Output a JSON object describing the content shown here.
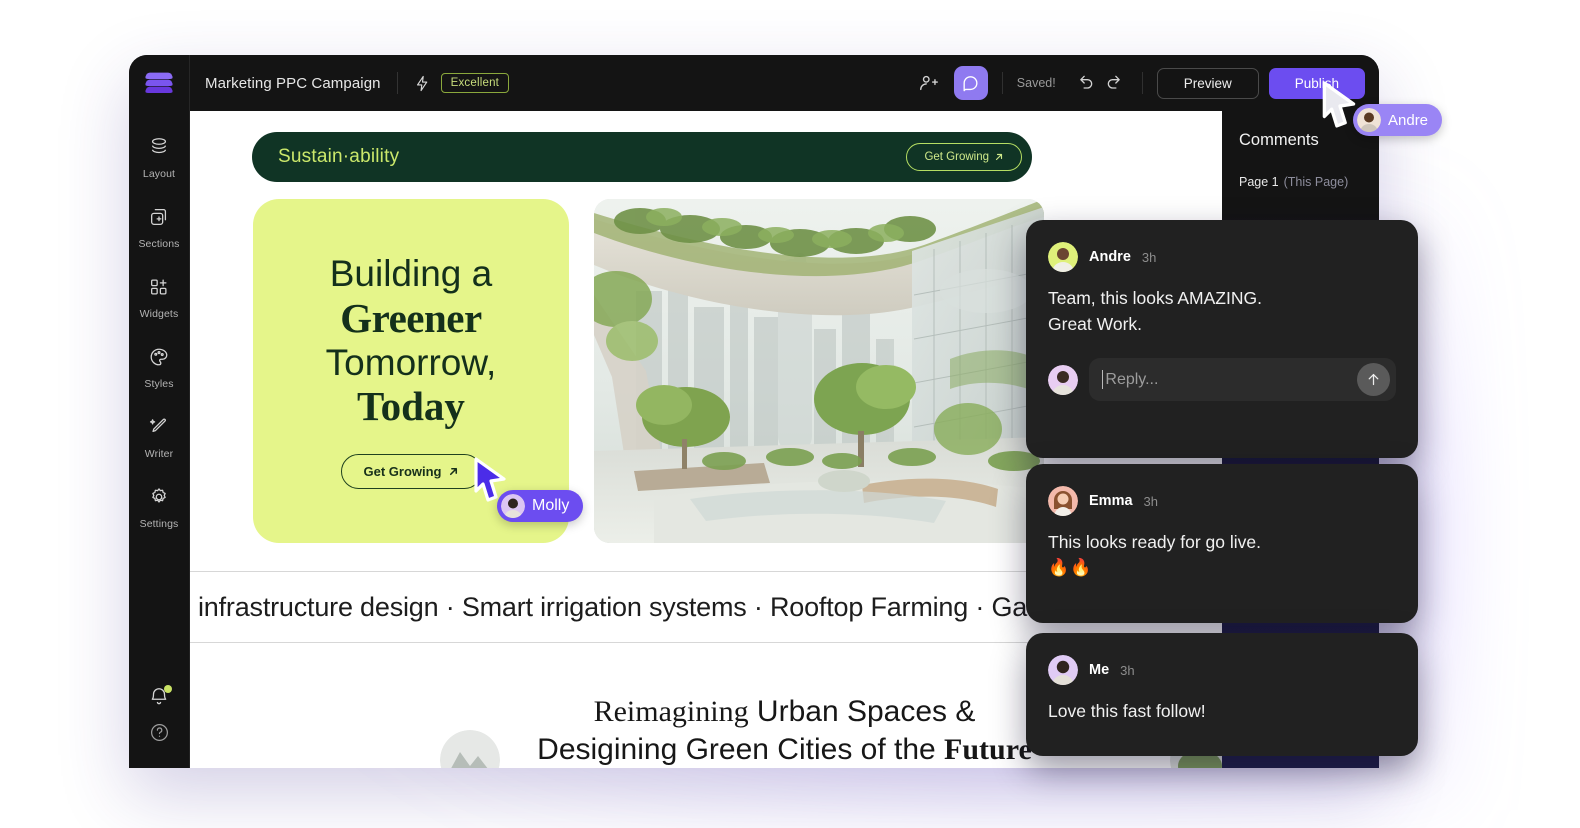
{
  "app": {
    "logo": "layers-logo",
    "document_title": "Marketing PPC Campaign",
    "score_icon": "lightning-icon",
    "score_badge": "Excellent"
  },
  "toolbar": {
    "invite_icon": "add-people-icon",
    "comment_toggle_icon": "comment-bubble-icon",
    "saved_label": "Saved!",
    "undo_icon": "undo-icon",
    "redo_icon": "redo-icon",
    "preview_label": "Preview",
    "publish_label": "Publish",
    "accent_color": "#6c4df0"
  },
  "sidebar": {
    "items": [
      {
        "label": "Layout",
        "icon": "layers-icon"
      },
      {
        "label": "Sections",
        "icon": "add-section-icon"
      },
      {
        "label": "Widgets",
        "icon": "widgets-grid-icon"
      },
      {
        "label": "Styles",
        "icon": "palette-icon"
      },
      {
        "label": "Writer",
        "icon": "magic-pen-icon"
      },
      {
        "label": "Settings",
        "icon": "gear-icon"
      }
    ],
    "bottom": [
      {
        "label": "Notifications",
        "icon": "bell-icon",
        "badge_color": "#c9e265"
      },
      {
        "label": "Help",
        "icon": "help-circle-icon"
      }
    ]
  },
  "canvas": {
    "banner": {
      "brand": "Sustain·ability",
      "cta": "Get Growing",
      "cta_icon": "arrow-up-right-icon",
      "bg_color": "#103425",
      "text_color": "#cbe86b"
    },
    "hero": {
      "line1": "Building a",
      "line2": "Greener",
      "line3": "Tomorrow,",
      "line4": "Today",
      "cta": "Get Growing",
      "cta_icon": "arrow-up-right-icon",
      "bg_color": "#e5f58a",
      "text_color": "#14301b"
    },
    "hero_image_alt": "futuristic green city terrace with trees and skyscrapers",
    "marquee": "infrastructure design  ·  Smart irrigation systems  ·  Rooftop Farming  ·  Gar",
    "bottom_section": {
      "line1_emphasis": "Reimagining",
      "line1_rest": " Urban Spaces &",
      "line2_rest": "Desigining Green Cities of the ",
      "line2_emphasis": "Future"
    }
  },
  "comments": {
    "title": "Comments",
    "list_icon": "list-view-icon",
    "close_icon": "close-icon",
    "page_label": "Page 1",
    "page_sub": "(This Page)",
    "collapse_icon": "chevron-up-icon",
    "threads": [
      {
        "author": "Andre",
        "time": "3h",
        "text_line1": "Team, this looks AMAZING.",
        "text_line2": "Great Work.",
        "reply_placeholder": "Reply...",
        "send_icon": "arrow-up-icon"
      },
      {
        "author": "Emma",
        "time": "3h",
        "text_line1": "This looks ready for go live.",
        "emoji": "🔥🔥"
      },
      {
        "author": "Me",
        "time": "3h",
        "text_line1": "Love this fast follow!"
      }
    ]
  },
  "cursors": [
    {
      "name": "Molly",
      "color": "#6c4df0"
    },
    {
      "name": "Andre",
      "color": "#9a85f5"
    }
  ]
}
